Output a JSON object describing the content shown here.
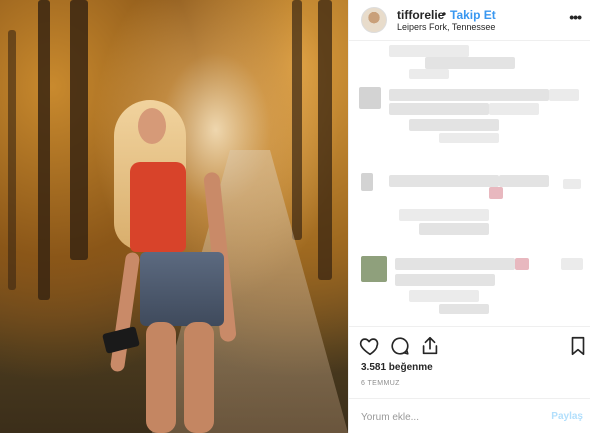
{
  "post": {
    "photo_description": "",
    "header": {
      "username": "tifforelie",
      "separator": "•",
      "follow_label": "Takip Et",
      "location": "Leipers Fork, Tennessee",
      "more_icon": "more-horizontal-icon"
    },
    "comments": {
      "pixelated": true
    },
    "actions": {
      "like_icon": "heart-icon",
      "comment_icon": "comment-icon",
      "share_icon": "share-icon",
      "save_icon": "bookmark-icon"
    },
    "likes_text": "3.581 beğenme",
    "date_text": "6 TEMMUZ",
    "comment_box": {
      "placeholder": "Yorum ekle...",
      "post_label": "Paylaş"
    },
    "colors": {
      "link_blue": "#3897f0",
      "post_disabled": "#b2dffc",
      "text": "#262626",
      "muted": "#8e8e8e",
      "divider": "#efefef"
    }
  }
}
